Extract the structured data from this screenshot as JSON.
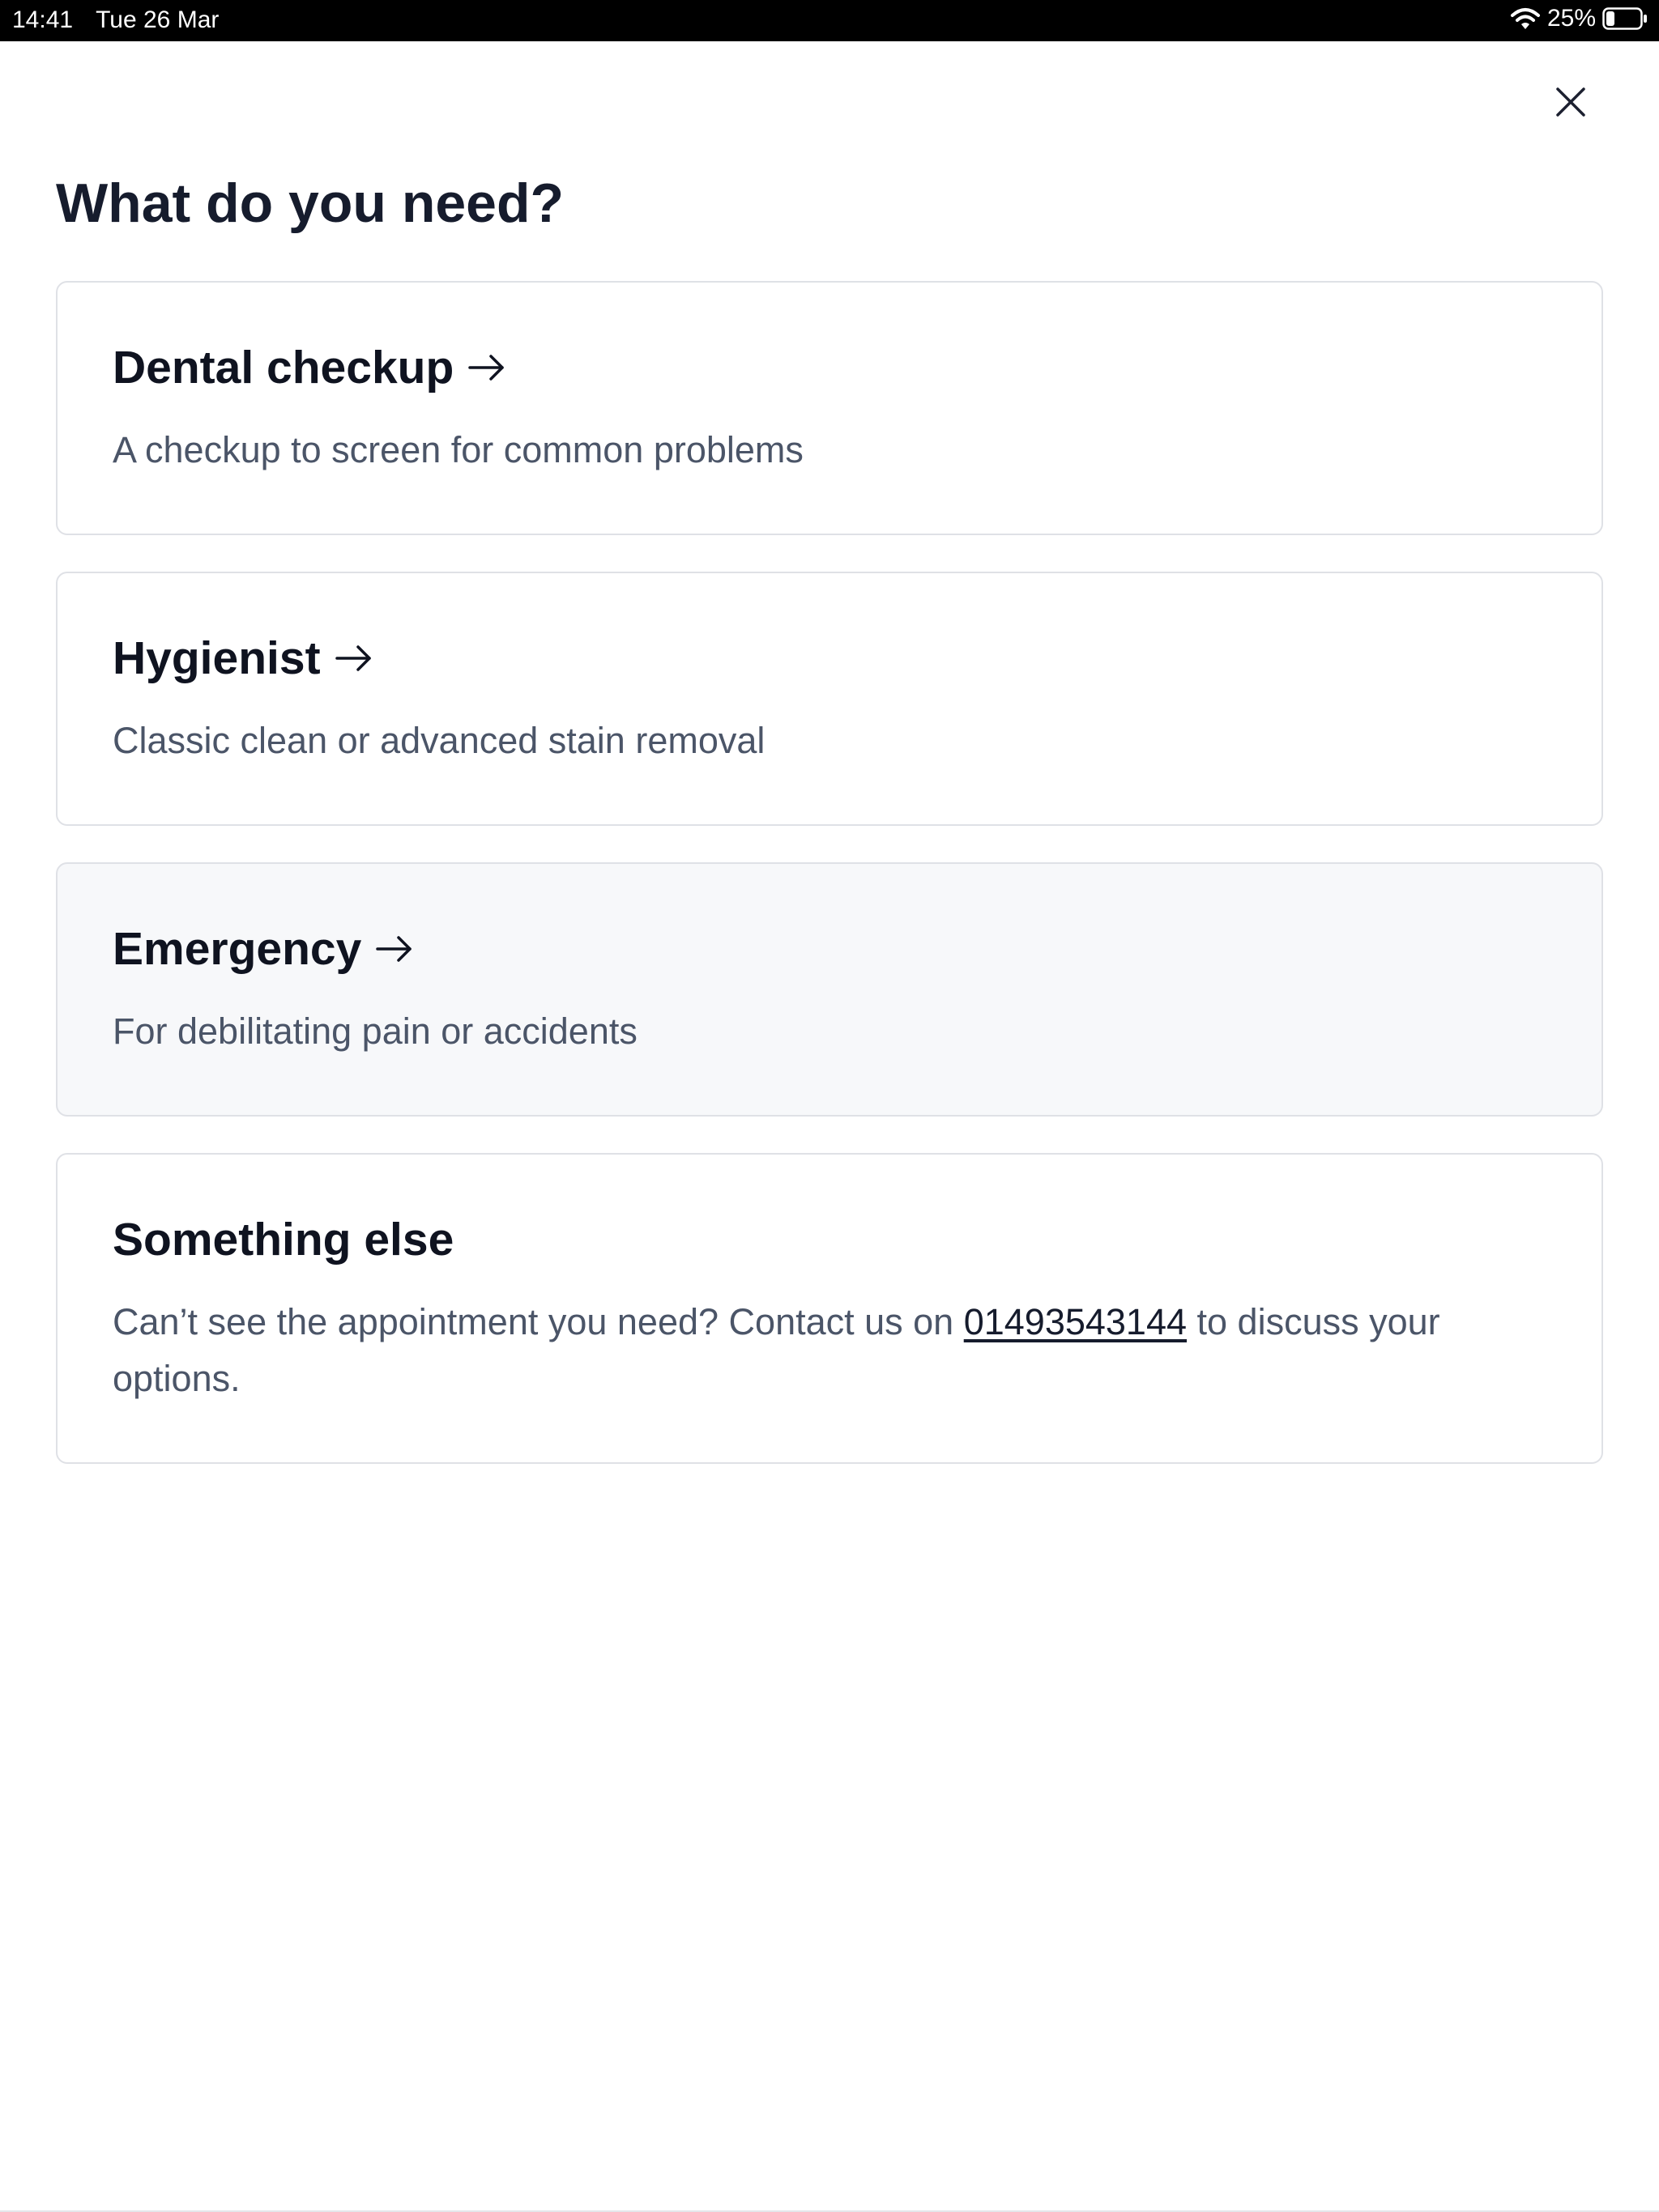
{
  "status_bar": {
    "time": "14:41",
    "date": "Tue 26 Mar",
    "battery_percent": "25%",
    "battery_level": 0.25
  },
  "page": {
    "title": "What do you need?",
    "close_icon": "close-icon"
  },
  "options": [
    {
      "title": "Dental checkup",
      "description": "A checkup to screen for common problems",
      "icon": "arrow-right-icon"
    },
    {
      "title": "Hygienist",
      "description": "Classic clean or advanced stain removal",
      "icon": "arrow-right-icon"
    },
    {
      "title": "Emergency",
      "description": "For debilitating pain or accidents",
      "icon": "arrow-right-icon"
    }
  ],
  "other": {
    "title": "Something else",
    "text_before": "Can’t see the appointment you need? Contact us on ",
    "phone": "01493543144",
    "text_after": " to discuss your options."
  },
  "colors": {
    "heading": "#161c2d",
    "description": "#4b5568",
    "card_border": "#dfe1e6",
    "card_highlight": "#f7f8fa"
  }
}
